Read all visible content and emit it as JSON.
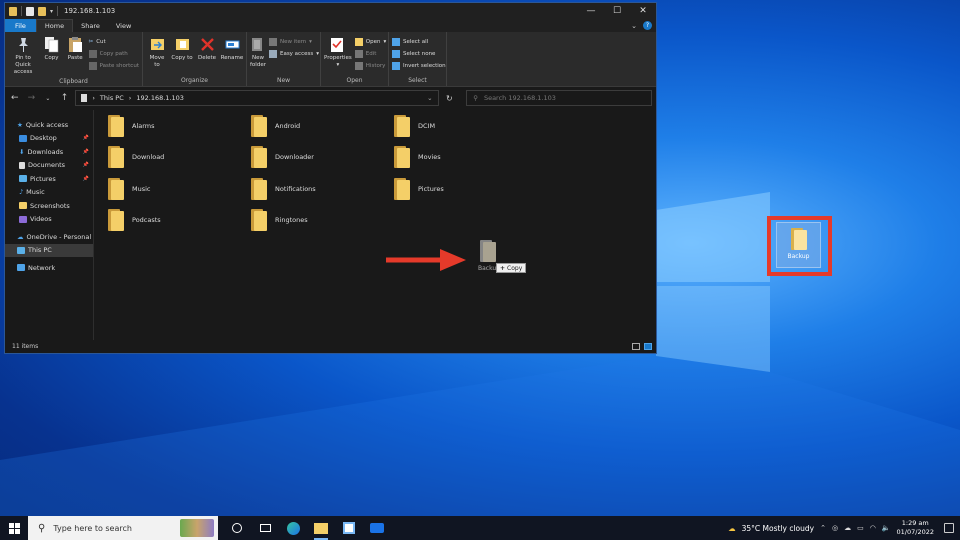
{
  "window": {
    "title": "192.168.1.103",
    "tabs": [
      "File",
      "Home",
      "Share",
      "View"
    ]
  },
  "ribbon": {
    "clipboard": {
      "label": "Clipboard",
      "pin": "Pin to Quick access",
      "copy": "Copy",
      "paste": "Paste",
      "cut": "Cut",
      "copy_path": "Copy path",
      "paste_shortcut": "Paste shortcut"
    },
    "organize": {
      "label": "Organize",
      "move_to": "Move to",
      "copy_to": "Copy to",
      "delete": "Delete",
      "rename": "Rename"
    },
    "new": {
      "label": "New",
      "new_folder": "New folder",
      "new_item": "New item",
      "easy_access": "Easy access"
    },
    "open": {
      "label": "Open",
      "properties": "Properties",
      "open": "Open",
      "edit": "Edit",
      "history": "History"
    },
    "select": {
      "label": "Select",
      "select_all": "Select all",
      "select_none": "Select none",
      "invert": "Invert selection"
    }
  },
  "address": {
    "crumbs": [
      "This PC",
      "192.168.1.103"
    ],
    "search_placeholder": "Search 192.168.1.103"
  },
  "nav": {
    "quick_access": "Quick access",
    "items": [
      "Desktop",
      "Downloads",
      "Documents",
      "Pictures",
      "Music",
      "Screenshots",
      "Videos"
    ],
    "onedrive": "OneDrive - Personal",
    "this_pc": "This PC",
    "network": "Network"
  },
  "folders": [
    "Alarms",
    "Android",
    "DCIM",
    "Download",
    "Downloader",
    "Movies",
    "Music",
    "Notifications",
    "Pictures",
    "Podcasts",
    "Ringtones"
  ],
  "status": {
    "count": "11 items"
  },
  "drag": {
    "label": "Backup",
    "tip": "Copy"
  },
  "desktop": {
    "icon_label": "Backup"
  },
  "taskbar": {
    "search_placeholder": "Type here to search",
    "weather": "35°C  Mostly cloudy",
    "time": "1:29 am",
    "date": "01/07/2022"
  },
  "colors": {
    "accent": "#1979ca",
    "highlight": "#e53a2a",
    "folder": "#f4cf68"
  }
}
